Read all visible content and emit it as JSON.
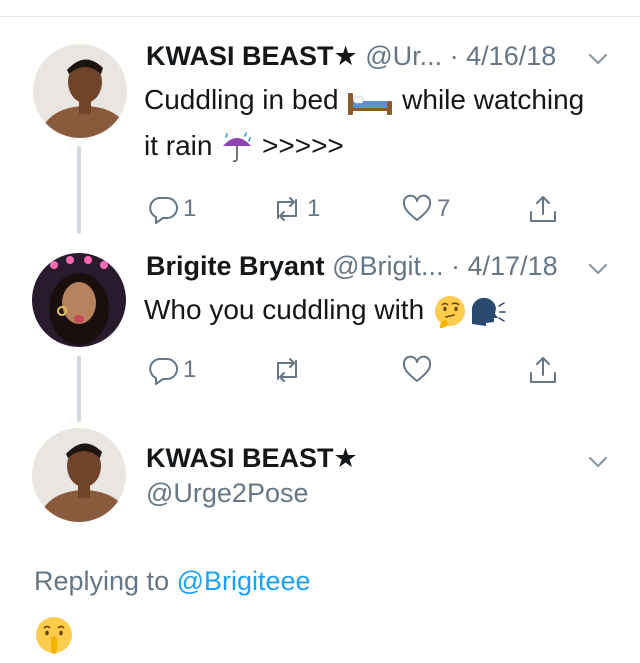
{
  "tweets": [
    {
      "name": "KWASI BEAST★",
      "handle": "@Ur...",
      "date": "· 4/16/18",
      "text_line1_a": "Cuddling in bed ",
      "text_line1_b": " while watching",
      "text_line2_a": "it rain ",
      "text_line2_b": " >>>>>",
      "emoji_1": "bed-emoji",
      "emoji_2": "umbrella-rain-emoji",
      "replies": "1",
      "retweets": "1",
      "likes": "7"
    },
    {
      "name": "Brigite Bryant",
      "handle": "@Brigit...",
      "date": "· 4/17/18",
      "text_a": "Who you cuddling with ",
      "emoji_1": "thinking-face-emoji",
      "emoji_2": "speaking-head-emoji",
      "replies": "1",
      "retweets": "",
      "likes": ""
    }
  ],
  "main_tweet": {
    "name": "KWASI BEAST★",
    "handle": "@Urge2Pose",
    "replying_prefix": "Replying to ",
    "replying_mention": "@Brigiteee",
    "text_emoji": "shushing-face-emoji"
  },
  "colors": {
    "text": "#14171a",
    "secondary": "#657786",
    "link": "#1da1f2",
    "thread_line": "#cfd9de"
  }
}
